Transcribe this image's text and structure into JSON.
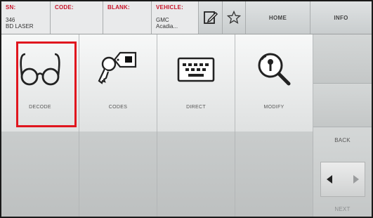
{
  "header": {
    "sn_label": "SN:",
    "sn_value_line1": "346",
    "sn_value_line2": "BD LASER",
    "code_label": "CODE:",
    "blank_label": "BLANK:",
    "vehicle_label": "VEHICLE:",
    "vehicle_value_line1": "GMC",
    "vehicle_value_line2": "Acadia...",
    "edit_icon": "edit-note-icon",
    "star_icon": "star-icon",
    "home_label": "HOME",
    "info_label": "INFO"
  },
  "tiles": [
    {
      "label": "DECODE",
      "icon": "glasses-icon",
      "highlighted": true
    },
    {
      "label": "CODES",
      "icon": "key-tag-icon"
    },
    {
      "label": "DIRECT",
      "icon": "keyboard-icon"
    },
    {
      "label": "MODIFY",
      "icon": "magnifier-key-icon"
    }
  ],
  "nav": {
    "back_label": "BACK",
    "next_label": "NEXT",
    "left_icon": "arrow-left-icon",
    "right_icon": "arrow-right-icon"
  },
  "colors": {
    "header_label_red": "#c8152a",
    "highlight_red": "#e0161e",
    "background_gray": "#c6c9c9"
  }
}
